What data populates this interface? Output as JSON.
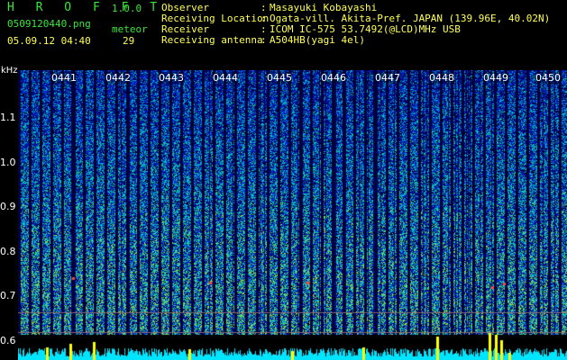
{
  "header": {
    "app_title": "H R O F F T",
    "app_version": "1.0.0",
    "file_name": "0509120440.png",
    "meteor_label": "meteor",
    "date_time": "05.09.12 04:40",
    "meteor_count": "29"
  },
  "info": [
    {
      "key": "Observer",
      "sep": ":",
      "value": "Masayuki Kobayashi"
    },
    {
      "key": "Receiving Location",
      "sep": ":",
      "value": "Ogata-vill. Akita-Pref. JAPAN (139.96E, 40.02N)"
    },
    {
      "key": "Receiver",
      "sep": ":",
      "value": "ICOM IC-575 53.7492(@LCD)MHz USB"
    },
    {
      "key": "Receiving antenna",
      "sep": ":",
      "value": "A504HB(yagi 4el)"
    }
  ],
  "axis": {
    "unit": "kHz",
    "ticks": [
      "1.1",
      "1.0",
      "0.9",
      "0.8",
      "0.7",
      "0.6"
    ],
    "time_labels": [
      "0441",
      "0442",
      "0443",
      "0444",
      "0445",
      "0446",
      "0447",
      "0448",
      "0449",
      "0450"
    ]
  },
  "colors": {
    "background": "#000000",
    "header_green": "#39e639",
    "header_yellow": "#ffff55",
    "spectrum_peaks": "#ffff00",
    "spectrum_base": "#00e5ff"
  }
}
